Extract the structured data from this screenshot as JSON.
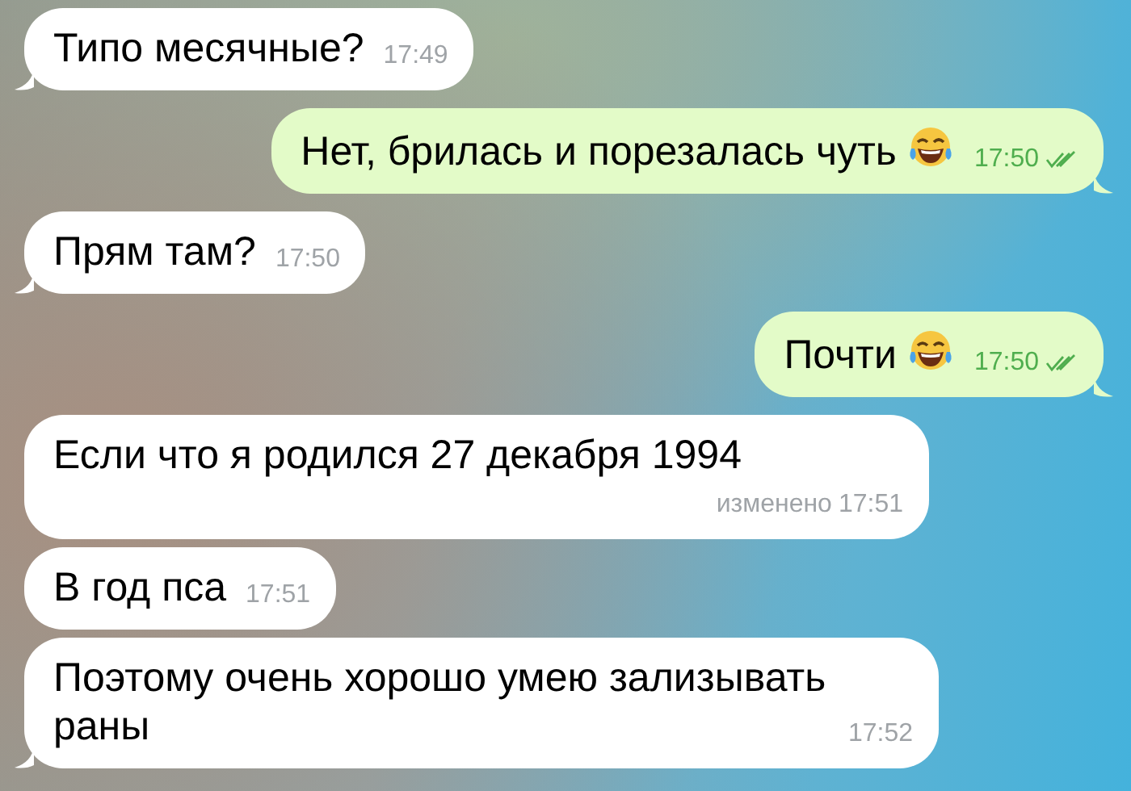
{
  "messages": [
    {
      "kind": "incoming",
      "text": "Типо месячные?",
      "time": "17:49",
      "tail": true
    },
    {
      "kind": "outgoing",
      "text": "Нет, брилась и порезалась чуть",
      "emoji": true,
      "time": "17:50",
      "read": true,
      "tail": true
    },
    {
      "kind": "incoming",
      "text": "Прям там?",
      "time": "17:50",
      "tail": true
    },
    {
      "kind": "outgoing",
      "text": "Почти",
      "emoji": true,
      "time": "17:50",
      "read": true,
      "tail": true
    },
    {
      "kind": "incoming",
      "text": "Если что я родился 27 декабря 1994",
      "edited": "изменено",
      "time": "17:51",
      "tail": false
    },
    {
      "kind": "incoming",
      "text": "В год пса",
      "time": "17:51",
      "tail": false
    },
    {
      "kind": "incoming",
      "text": "Поэтому очень хорошо умею зализывать раны",
      "time": "17:52",
      "tail": true
    }
  ]
}
